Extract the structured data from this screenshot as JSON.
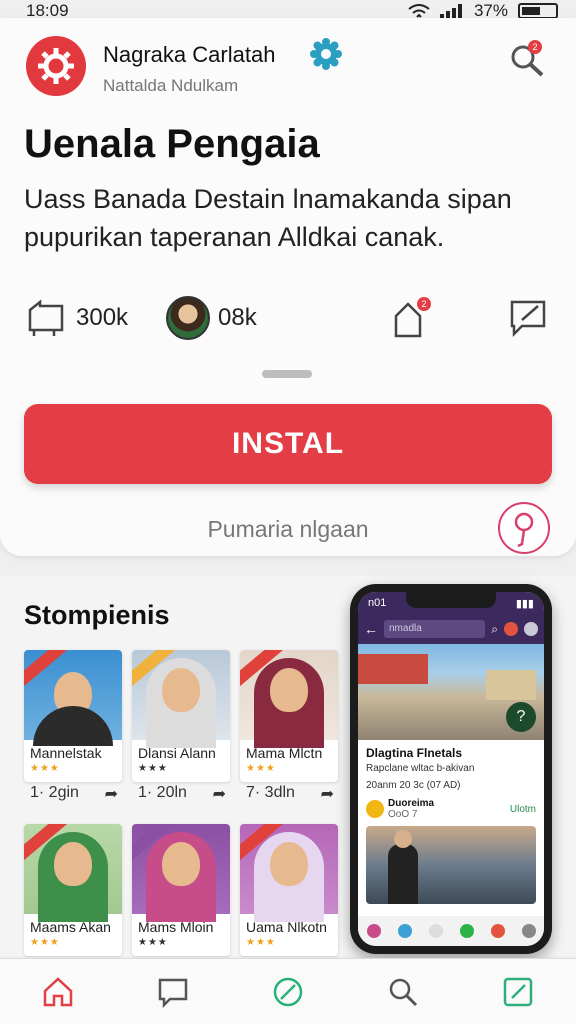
{
  "status_bar": {
    "time": "18:09",
    "battery": "37%"
  },
  "developer": {
    "name": "Nagraka Carlatah",
    "subtitle": "Nattalda Ndulkam"
  },
  "app": {
    "title": "Uenala Pengaia",
    "description": "Uass Banada Destain lnamakanda sipan pupurikan taperanan Alldkai canak."
  },
  "stats": {
    "downloads": "300k",
    "reviews": "08k",
    "notification_badge": "2"
  },
  "install_label": "INSTAL",
  "secondary_link": "Pumaria nlgaan",
  "section": {
    "title": "Stompienis",
    "cards": [
      {
        "name": "Mannelstak",
        "meta_left": "1· 2gin",
        "colors": [
          "#3a8fd1",
          "#2b2b2b"
        ],
        "ribbon": "#e0413a"
      },
      {
        "name": "Dlansi Alann",
        "meta_left": "1· 20ln",
        "colors": [
          "#b9c8d8",
          "#dcdcdc"
        ],
        "ribbon": "#f0b23a"
      },
      {
        "name": "Mama Mlctn",
        "meta_left": "7· 3dln",
        "colors": [
          "#e3d6c9",
          "#8a2a40"
        ],
        "ribbon": "#e0413a"
      },
      {
        "name": "Maams Akan",
        "meta_left": "",
        "colors": [
          "#6cb56a",
          "#3d8f4a"
        ],
        "ribbon": "#e0413a"
      },
      {
        "name": "Mams Mloin",
        "meta_left": "",
        "colors": [
          "#8b4fa3",
          "#c74d8a"
        ],
        "ribbon": "#8b4fa3"
      },
      {
        "name": "Uama Nlkotn",
        "meta_left": "",
        "colors": [
          "#b567b8",
          "#e6d6f0"
        ],
        "ribbon": "#e0413a"
      }
    ]
  },
  "phone": {
    "status_time": "n01",
    "search_text": "nmadla",
    "title": "Dlagtina Flnetals",
    "subtitle1": "Rapclane wltac b-akivan",
    "subtitle2": "20anm 20 3c (07 AD)",
    "row_label": "Duoreima",
    "row_sub": "OoO 7",
    "row_tag": "Ulotm"
  },
  "colors": {
    "accent": "#e33d45",
    "verified": "#2a9fc1",
    "phone_bar": "#3c2a5e"
  }
}
